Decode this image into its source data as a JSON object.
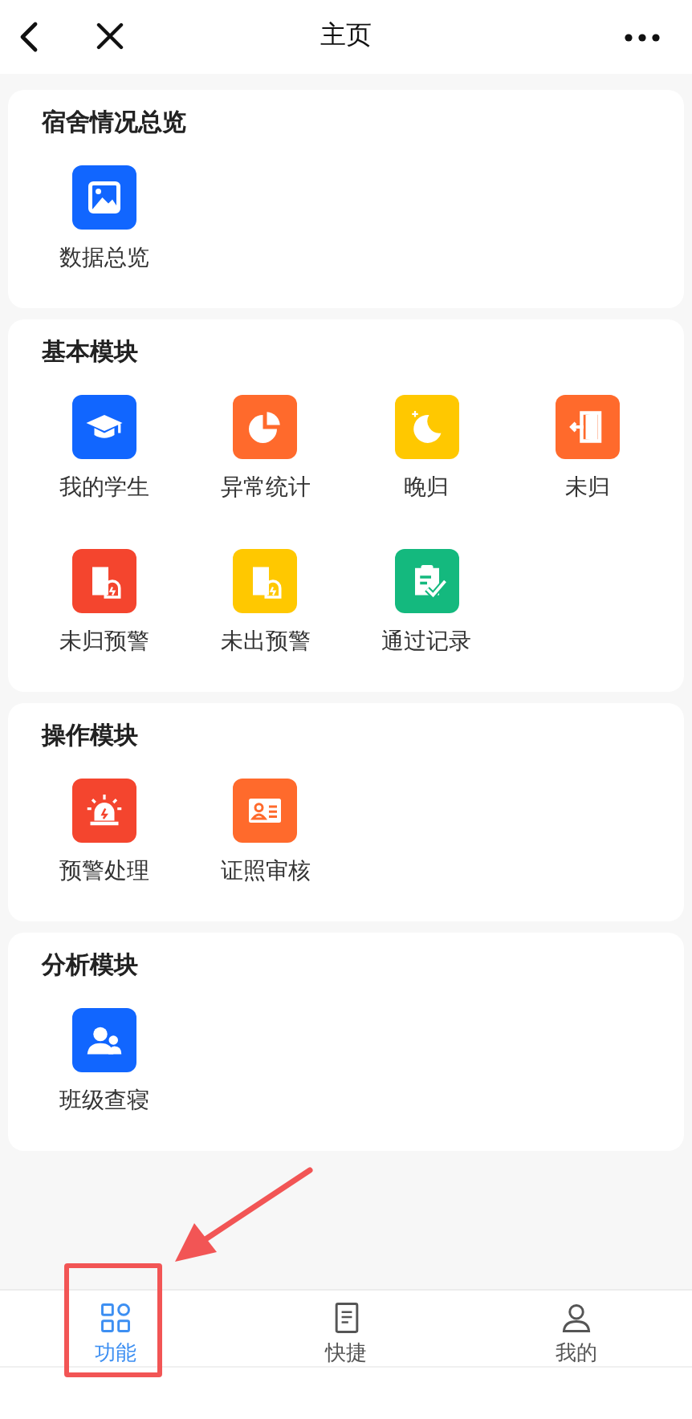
{
  "header": {
    "title": "主页"
  },
  "sections": [
    {
      "title": "宿舍情况总览",
      "items": [
        {
          "label": "数据总览",
          "kind": "image",
          "color": "#1166ff"
        }
      ]
    },
    {
      "title": "基本模块",
      "items": [
        {
          "label": "我的学生",
          "kind": "cap",
          "color": "#1166ff"
        },
        {
          "label": "异常统计",
          "kind": "pie",
          "color": "#ff6a2c"
        },
        {
          "label": "晚归",
          "kind": "moon",
          "color": "#ffc800"
        },
        {
          "label": "未归",
          "kind": "door",
          "color": "#ff6a2c"
        },
        {
          "label": "未归预警",
          "kind": "door-alarm",
          "color": "#f4452e"
        },
        {
          "label": "未出预警",
          "kind": "door-alarm",
          "color": "#ffc800"
        },
        {
          "label": "通过记录",
          "kind": "clipboard",
          "color": "#14b97e"
        }
      ]
    },
    {
      "title": "操作模块",
      "items": [
        {
          "label": "预警处理",
          "kind": "siren",
          "color": "#f4452e"
        },
        {
          "label": "证照审核",
          "kind": "idcard",
          "color": "#ff6a2c"
        }
      ]
    },
    {
      "title": "分析模块",
      "items": [
        {
          "label": "班级查寝",
          "kind": "people",
          "color": "#1166ff"
        }
      ]
    }
  ],
  "tabs": [
    {
      "label": "功能",
      "kind": "grid",
      "selected": true
    },
    {
      "label": "快捷",
      "kind": "doc",
      "selected": false
    },
    {
      "label": "我的",
      "kind": "person",
      "selected": false
    }
  ]
}
